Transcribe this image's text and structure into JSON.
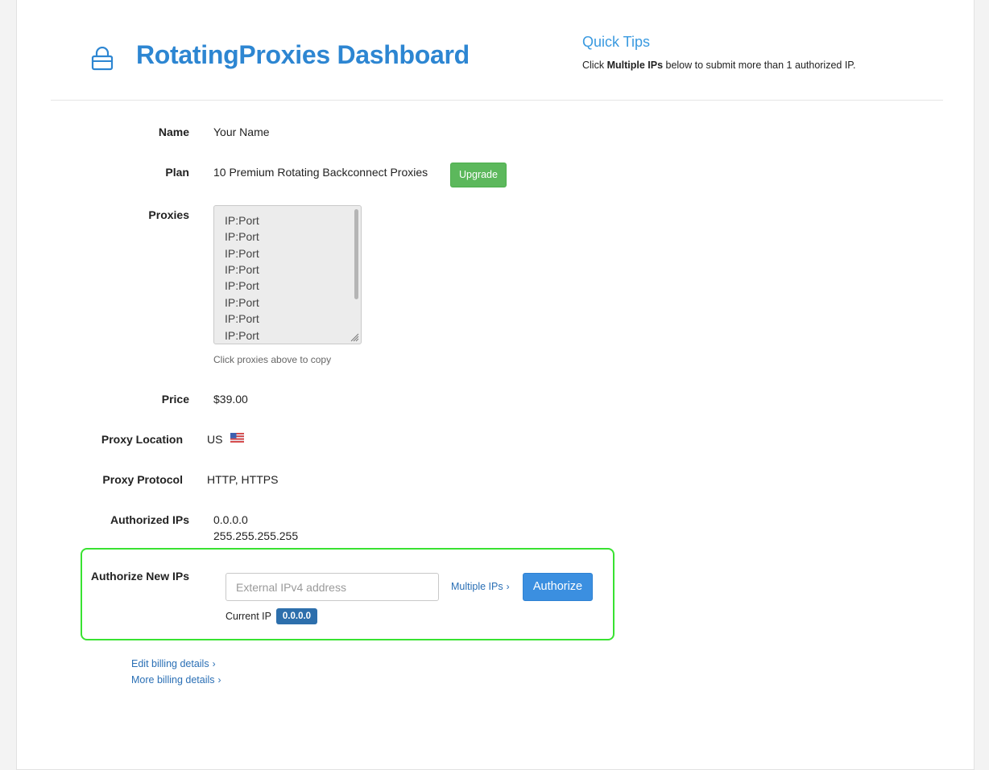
{
  "header": {
    "title": "RotatingProxies Dashboard",
    "icon": "lock-icon",
    "accent_color": "#2d86d2"
  },
  "quick_tips": {
    "title": "Quick Tips",
    "text_prefix": "Click ",
    "text_bold": "Multiple IPs",
    "text_suffix": " below to submit more than 1 authorized IP."
  },
  "account": {
    "name_label": "Name",
    "name_value": "Your Name",
    "plan_label": "Plan",
    "plan_value": "10 Premium Rotating Backconnect Proxies",
    "upgrade_button": "Upgrade",
    "proxies_label": "Proxies",
    "proxies": [
      "IP:Port",
      "IP:Port",
      "IP:Port",
      "IP:Port",
      "IP:Port",
      "IP:Port",
      "IP:Port",
      "IP:Port"
    ],
    "proxies_hint": "Click proxies above to copy",
    "price_label": "Price",
    "price_value": "$39.00",
    "location_label": "Proxy Location",
    "location_value": "US",
    "location_flag": "us-flag-icon",
    "protocol_label": "Proxy Protocol",
    "protocol_value": "HTTP, HTTPS",
    "authorized_label": "Authorized IPs",
    "authorized_ips": [
      "0.0.0.0",
      "255.255.255.255"
    ]
  },
  "authorize": {
    "label": "Authorize New IPs",
    "input_placeholder": "External IPv4 address",
    "input_value": "",
    "multiple_link": "Multiple IPs",
    "button": "Authorize",
    "current_ip_label": "Current IP",
    "current_ip_value": "0.0.0.0",
    "highlight_color": "#39e231",
    "button_color": "#3b8fe0"
  },
  "billing": {
    "edit_link": "Edit billing details",
    "more_link": "More billing details"
  }
}
